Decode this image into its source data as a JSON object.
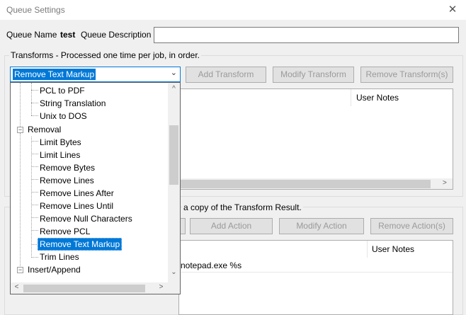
{
  "window": {
    "title": "Queue Settings",
    "close_glyph": "✕"
  },
  "queue": {
    "name_label": "Queue Name",
    "name_value": "test",
    "description_label": "Queue Description",
    "description_value": ""
  },
  "transforms_group": {
    "label": "Transforms - Processed one time per job, in order.",
    "combo_value": "Remove Text Markup",
    "add_button": "Add Transform",
    "modify_button": "Modify Transform",
    "remove_button": "Remove Transform(s)",
    "list_columns": [
      "User Notes"
    ]
  },
  "actions_group": {
    "label": "a copy of the Transform Result.",
    "add_button": "Add Action",
    "modify_button": "Modify Action",
    "remove_button": "Remove Action(s)",
    "list_columns": [
      "User Notes"
    ],
    "rows": [
      {
        "command": "notepad.exe %s"
      }
    ]
  },
  "dropdown": {
    "items": [
      {
        "label": "PCL to PDF"
      },
      {
        "label": "String Translation"
      },
      {
        "label": "Unix to DOS"
      },
      {
        "label": "Removal"
      },
      {
        "label": "Limit Bytes"
      },
      {
        "label": "Limit Lines"
      },
      {
        "label": "Remove Bytes"
      },
      {
        "label": "Remove Lines"
      },
      {
        "label": "Remove Lines After"
      },
      {
        "label": "Remove Lines Until"
      },
      {
        "label": "Remove Null Characters"
      },
      {
        "label": "Remove PCL"
      },
      {
        "label": "Remove Text Markup",
        "selected": true
      },
      {
        "label": "Trim Lines"
      },
      {
        "label": "Insert/Append"
      }
    ]
  },
  "icons": {
    "collapse": "−",
    "combo_arrow": "⌄",
    "scroll_up": "^",
    "scroll_down": "⌄",
    "scroll_left": "<",
    "scroll_right": ">"
  },
  "colors": {
    "selection": "#0078d7",
    "selection_text": "#ffffff"
  }
}
